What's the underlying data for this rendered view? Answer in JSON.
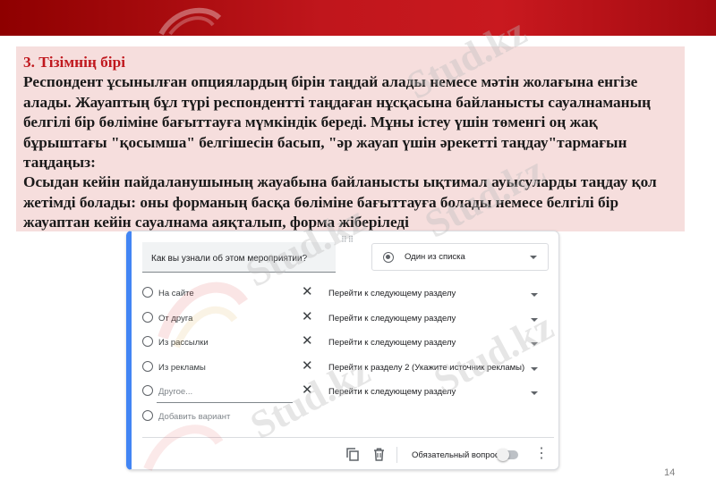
{
  "slide": {
    "heading": "3. Тізімнің бірі",
    "paragraph1": "Респондент ұсынылған опциялардың бірін таңдай алады немесе мәтін жолағына енгізе алады. Жауаптың бұл түрі респондентті таңдаған нұсқасына байланысты сауалнаманың белгілі бір бөліміне бағыттауға мүмкіндік береді. Мұны істеу үшін төменгі оң жақ бұрыштағы \"қосымша\" белгішесін басып, \"әр жауап үшін әрекетті таңдау\"тармағын таңдаңыз:",
    "paragraph2": "Осыдан кейін пайдаланушының жауабына байланысты ықтимал ауысуларды таңдау қол жетімді болады: оны форманың басқа бөліміне бағыттауға болады немесе белгілі бір жауаптан кейін сауалнама аяқталып, форма жіберіледі",
    "page_number": "14",
    "watermark": "Stud.kz"
  },
  "form": {
    "question": "Как вы узнали об этом мероприятии?",
    "question_type": "Один из списка",
    "options": [
      {
        "label": "На сайте",
        "goto": "Перейти к следующему разделу"
      },
      {
        "label": "От друга",
        "goto": "Перейти к следующему разделу"
      },
      {
        "label": "Из рассылки",
        "goto": "Перейти к следующему разделу"
      },
      {
        "label": "Из рекламы",
        "goto": "Перейти к разделу 2 (Укажите источник рекламы)"
      },
      {
        "label": "Другое...",
        "goto": "Перейти к следующему разделу"
      }
    ],
    "add_option": "Добавить вариант",
    "required_label": "Обязательный вопрос",
    "required_on": false,
    "icons": [
      "drag-handle-icon",
      "radio-icon",
      "close-icon",
      "chevron-down-icon",
      "copy-icon",
      "trash-icon",
      "more-vert-icon"
    ]
  },
  "colors": {
    "banner": "#c0161c",
    "text_box_bg": "#f6dedd",
    "heading": "#c0181e",
    "card_accent": "#4285f4"
  }
}
